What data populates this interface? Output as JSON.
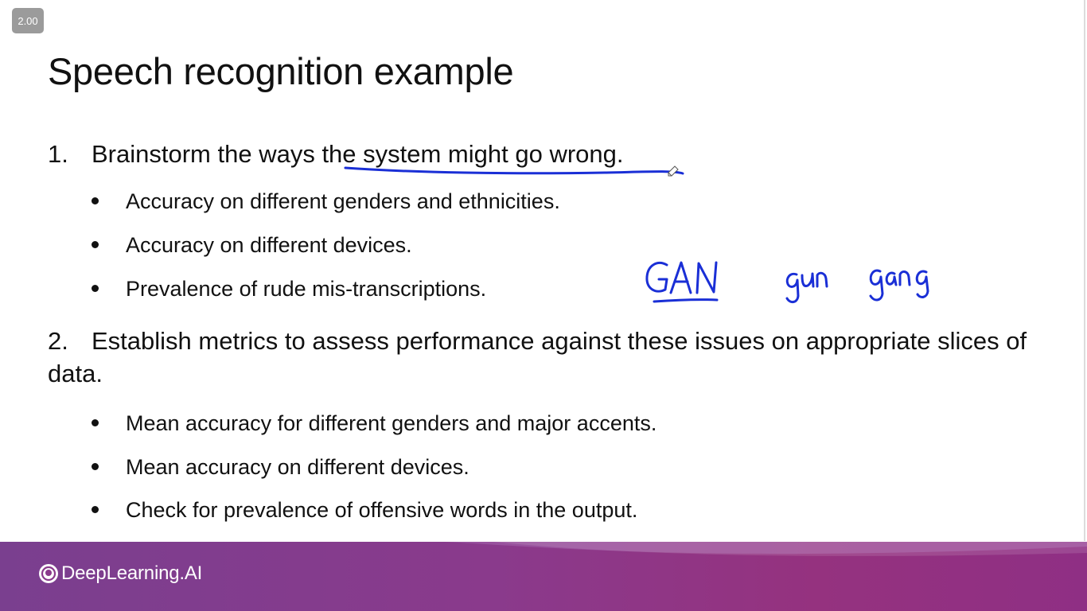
{
  "player": {
    "speed_label": "2.00"
  },
  "slide": {
    "title": "Speech recognition example",
    "item1": {
      "number": "1.",
      "text_before": "Brainstorm the ways ",
      "text_emphasis": "the system might go wrong."
    },
    "item1_bullets": [
      "Accuracy on different genders and ethnicities.",
      "Accuracy on different devices.",
      "Prevalence of rude mis-transcriptions."
    ],
    "item2": {
      "number": "2.",
      "text": "Establish metrics to assess performance against these issues on appropriate slices of data."
    },
    "item2_bullets": [
      "Mean accuracy for different genders and major accents.",
      "Mean accuracy on different devices.",
      "Check for prevalence of offensive words in the output."
    ]
  },
  "handwriting": {
    "word1": "GAN",
    "word2": "gun",
    "word3": "gang",
    "ink_color": "#1a2fd6"
  },
  "footer": {
    "brand": "DeepLearning.AI"
  },
  "colors": {
    "footer_start": "#7a3f8f",
    "footer_end": "#8f2f84",
    "text": "#111111"
  }
}
